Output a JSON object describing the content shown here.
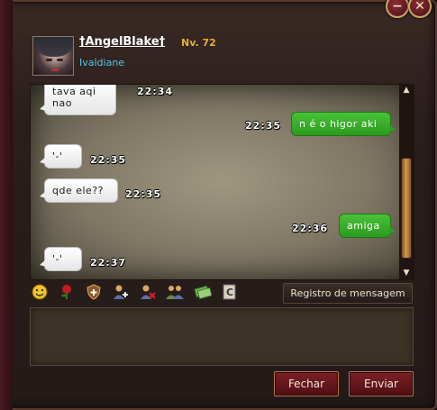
{
  "window": {
    "minimize_glyph": "−",
    "close_glyph": "✕"
  },
  "profile": {
    "name": "†AngelBlake†",
    "level": "Nv. 72",
    "guild": "Ivaldiane"
  },
  "messages": [
    {
      "side": "in",
      "text": "tava aqi nao",
      "time": "22:34"
    },
    {
      "side": "out",
      "text": "n é o higor aki",
      "time": "22:35"
    },
    {
      "side": "in",
      "text": "'-'",
      "time": "22:35"
    },
    {
      "side": "in",
      "text": "qde ele??",
      "time": "22:35"
    },
    {
      "side": "out",
      "text": "amiga",
      "time": "22:36"
    },
    {
      "side": "in",
      "text": "'-'",
      "time": "22:37"
    }
  ],
  "toolbar": {
    "icons": [
      "emoji-icon",
      "rose-icon",
      "add-shield-icon",
      "add-friend-icon",
      "remove-friend-icon",
      "group-icon",
      "money-icon",
      "copy-c-icon"
    ],
    "log_label": "Registro de mensagem"
  },
  "input": {
    "value": ""
  },
  "buttons": {
    "close_label": "Fechar",
    "send_label": "Enviar"
  },
  "colors": {
    "incoming_bubble": "#ffffff",
    "outgoing_bubble": "#3fb22e",
    "name_text": "#ffffff",
    "level_text": "#e2b040",
    "guild_text": "#52c7ea",
    "button_red": "#6a161c"
  }
}
